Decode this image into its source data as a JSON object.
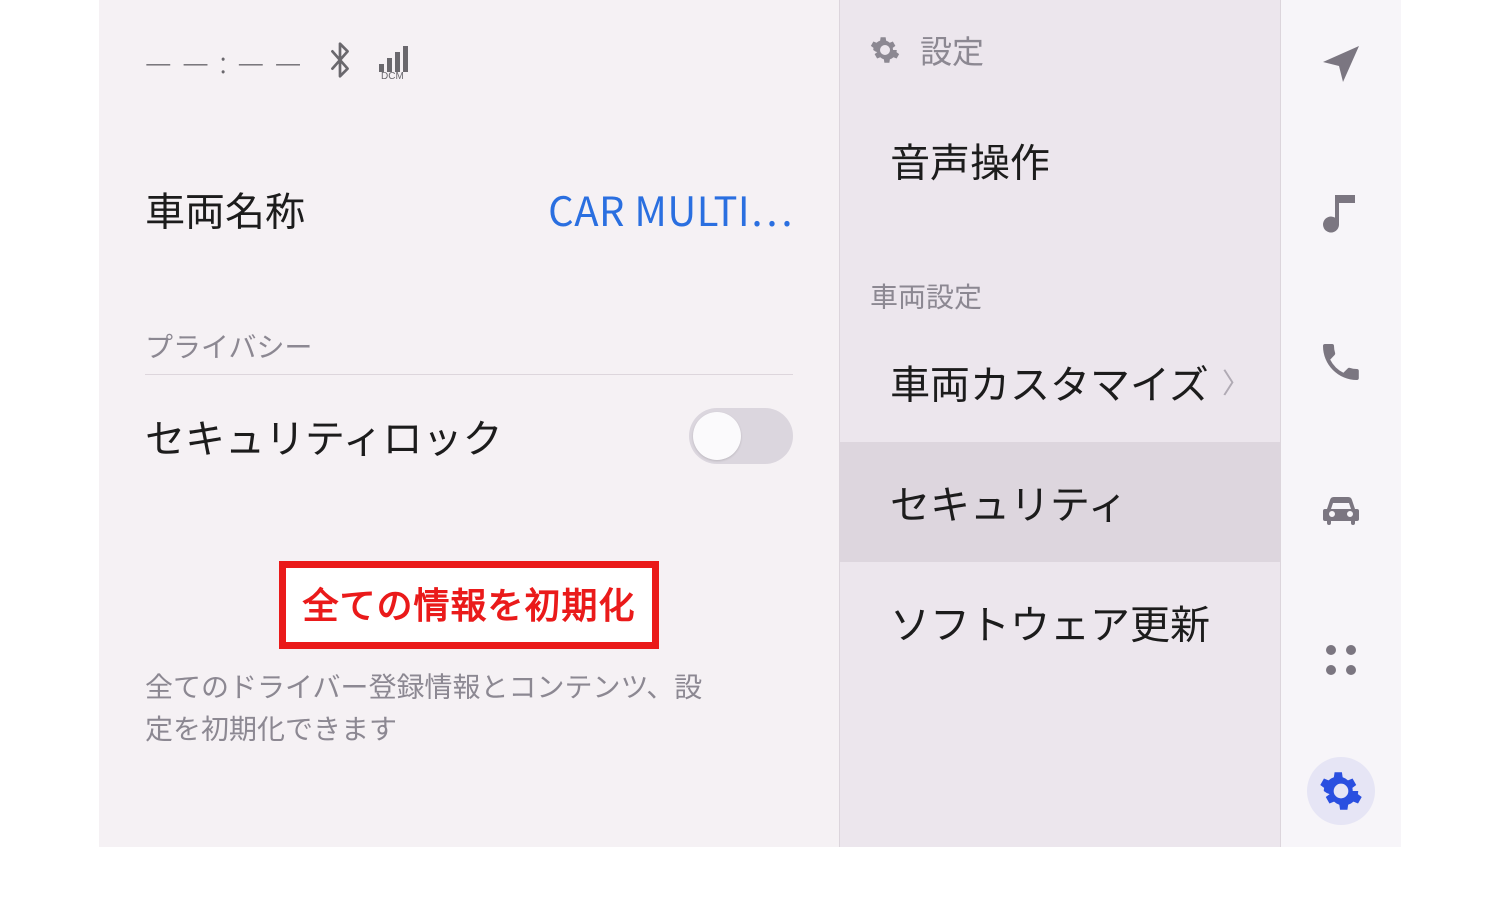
{
  "status_bar": {
    "clock": "— — : — —"
  },
  "left": {
    "vehicle_name_label": "車両名称",
    "vehicle_name_value": "CAR MULTI…",
    "privacy_label": "プライバシー",
    "security_lock_label": "セキュリティロック",
    "security_lock_on": false,
    "reset_button_label": "全ての情報を初期化",
    "reset_description": "全てのドライバー登録情報とコンテンツ、設定を初期化できます"
  },
  "mid": {
    "title": "設定",
    "section_vehicle": "車両設定",
    "items": [
      {
        "label": "音声操作",
        "has_chevron": false,
        "selected": false
      },
      {
        "label": "車両カスタマイズ",
        "has_chevron": true,
        "selected": false
      },
      {
        "label": "セキュリティ",
        "has_chevron": false,
        "selected": true
      },
      {
        "label": "ソフトウェア更新",
        "has_chevron": false,
        "selected": false
      }
    ]
  },
  "rail": {
    "icons": [
      "navigation-arrow",
      "music-note",
      "phone",
      "car",
      "apps-grid",
      "settings-gear"
    ],
    "active": "settings-gear"
  }
}
